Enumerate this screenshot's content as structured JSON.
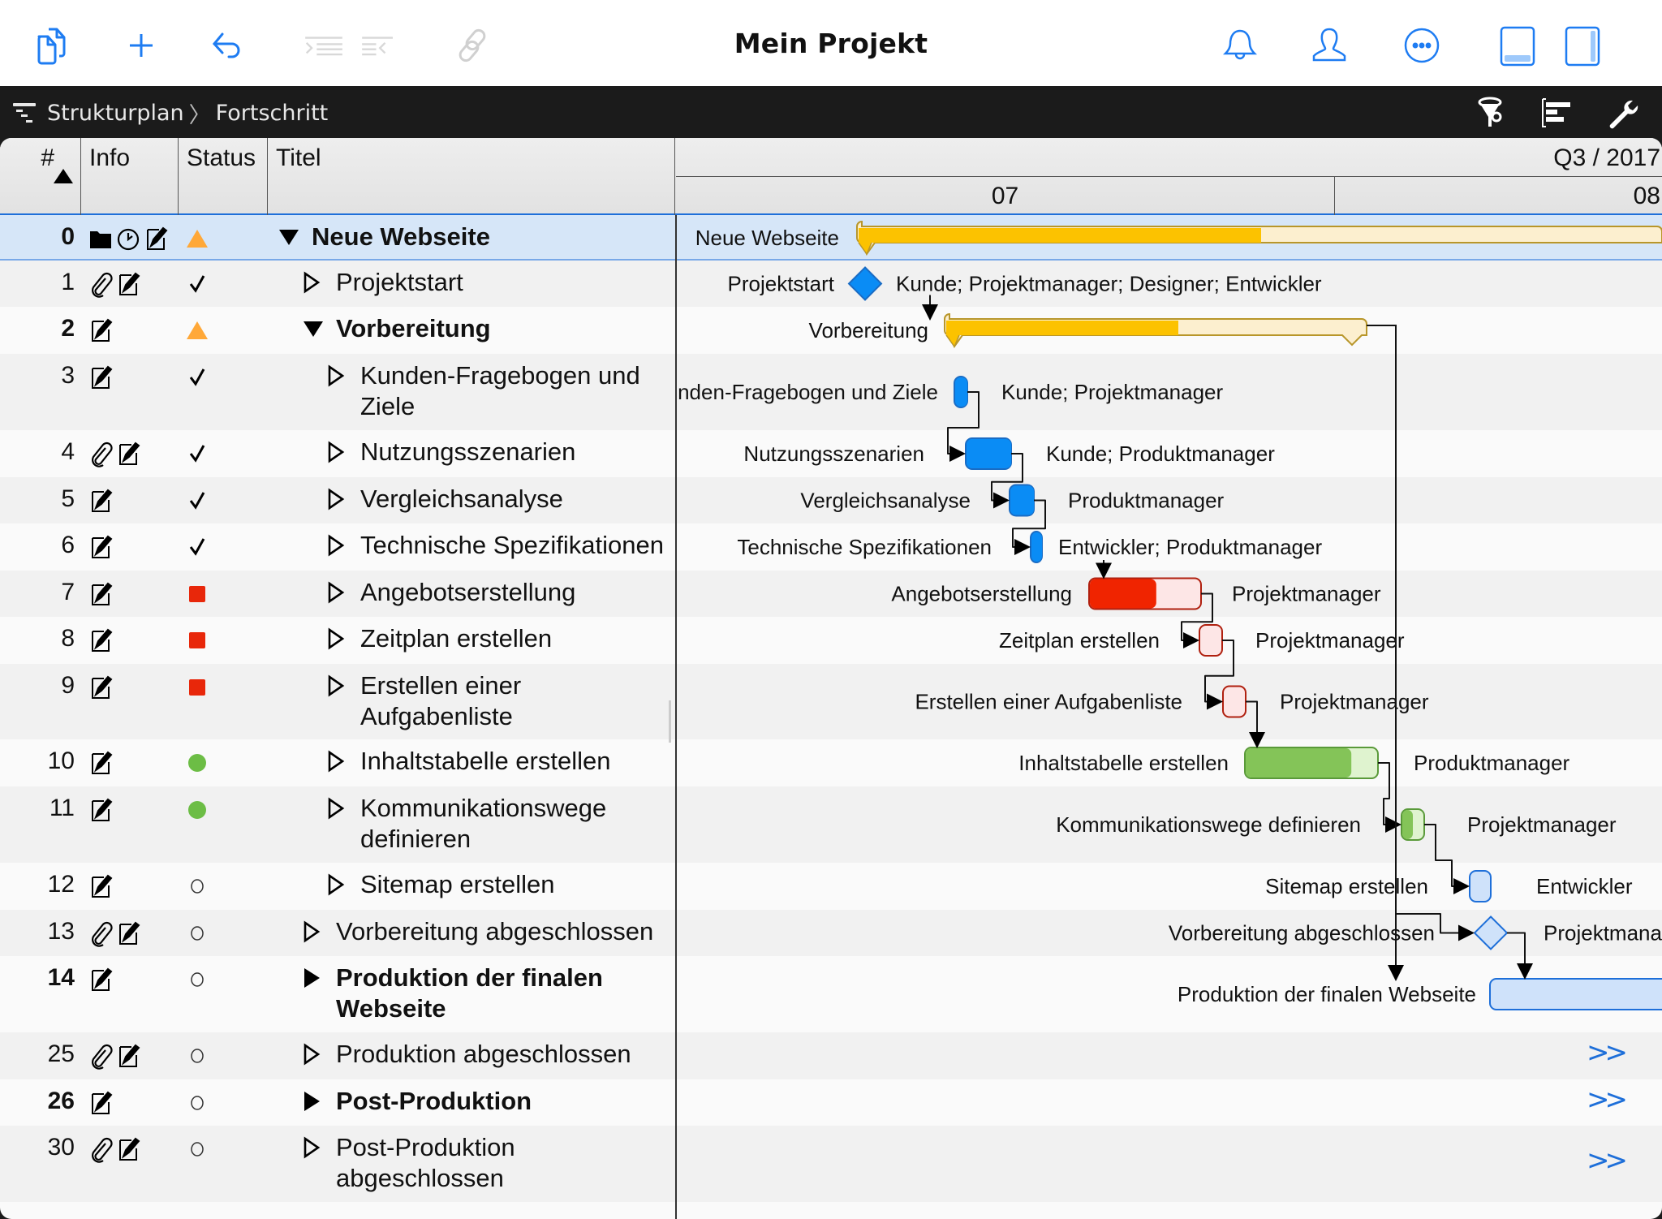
{
  "app": {
    "title": "Mein Projekt"
  },
  "toolbar": {
    "left_icons": [
      "duplicate-icon",
      "add-icon",
      "undo-icon",
      "indent-icon",
      "outdent-icon",
      "link-icon"
    ],
    "right_icons": [
      "bell-icon",
      "person-icon",
      "more-icon",
      "bottom-panel-icon",
      "side-panel-icon"
    ]
  },
  "breadcrumb": {
    "items": [
      "Strukturplan",
      "Fortschritt"
    ],
    "right_icons": [
      "filter-icon",
      "gantt-view-icon",
      "wrench-icon"
    ]
  },
  "table": {
    "columns": [
      "#",
      "Info",
      "Status",
      "Titel"
    ],
    "sort": "ascending",
    "rows": [
      {
        "num": "0",
        "bold": true,
        "info": [
          "folder",
          "clock",
          "note"
        ],
        "status": "warning-triangle",
        "expander": "expanded",
        "indent": 0,
        "title": "Neue Webseite",
        "selected": true
      },
      {
        "num": "1",
        "bold": false,
        "info": [
          "attachment",
          "note"
        ],
        "status": "check",
        "expander": "collapsed-outline",
        "indent": 1,
        "title": "Projektstart"
      },
      {
        "num": "2",
        "bold": true,
        "info": [
          "note"
        ],
        "status": "warning-triangle",
        "expander": "expanded",
        "indent": 1,
        "title": "Vorbereitung"
      },
      {
        "num": "3",
        "bold": false,
        "info": [
          "note"
        ],
        "status": "check",
        "expander": "collapsed-outline",
        "indent": 2,
        "title": "Kunden-Fragebogen und Ziele",
        "title_lines": [
          "Kunden-Fragebogen und",
          "Ziele"
        ]
      },
      {
        "num": "4",
        "bold": false,
        "info": [
          "attachment",
          "note"
        ],
        "status": "check",
        "expander": "collapsed-outline",
        "indent": 2,
        "title": "Nutzungsszenarien"
      },
      {
        "num": "5",
        "bold": false,
        "info": [
          "note"
        ],
        "status": "check",
        "expander": "collapsed-outline",
        "indent": 2,
        "title": "Vergleichsanalyse"
      },
      {
        "num": "6",
        "bold": false,
        "info": [
          "note"
        ],
        "status": "check",
        "expander": "collapsed-outline",
        "indent": 2,
        "title": "Technische Spezifikationen"
      },
      {
        "num": "7",
        "bold": false,
        "info": [
          "note"
        ],
        "status": "red-square",
        "expander": "collapsed-outline",
        "indent": 2,
        "title": "Angebotserstellung"
      },
      {
        "num": "8",
        "bold": false,
        "info": [
          "note"
        ],
        "status": "red-square",
        "expander": "collapsed-outline",
        "indent": 2,
        "title": "Zeitplan erstellen"
      },
      {
        "num": "9",
        "bold": false,
        "info": [
          "note"
        ],
        "status": "red-square",
        "expander": "collapsed-outline",
        "indent": 2,
        "title": "Erstellen einer Aufgabenliste",
        "title_lines": [
          "Erstellen einer",
          "Aufgabenliste"
        ]
      },
      {
        "num": "10",
        "bold": false,
        "info": [
          "note"
        ],
        "status": "green-dot",
        "expander": "collapsed-outline",
        "indent": 2,
        "title": "Inhaltstabelle erstellen"
      },
      {
        "num": "11",
        "bold": false,
        "info": [
          "note"
        ],
        "status": "green-dot",
        "expander": "collapsed-outline",
        "indent": 2,
        "title": "Kommunikationswege definieren",
        "title_lines": [
          "Kommunikationswege",
          "definieren"
        ]
      },
      {
        "num": "12",
        "bold": false,
        "info": [
          "note"
        ],
        "status": "empty-circle",
        "expander": "collapsed-outline",
        "indent": 2,
        "title": "Sitemap erstellen"
      },
      {
        "num": "13",
        "bold": false,
        "info": [
          "attachment",
          "note"
        ],
        "status": "empty-circle",
        "expander": "collapsed-outline",
        "indent": 1,
        "title": "Vorbereitung abgeschlossen"
      },
      {
        "num": "14",
        "bold": true,
        "info": [
          "note"
        ],
        "status": "empty-circle",
        "expander": "collapsed-filled",
        "indent": 1,
        "title": "Produktion der finalen Webseite",
        "title_lines": [
          "Produktion der finalen",
          "Webseite"
        ]
      },
      {
        "num": "25",
        "bold": false,
        "info": [
          "attachment",
          "note"
        ],
        "status": "empty-circle",
        "expander": "collapsed-outline",
        "indent": 1,
        "title": "Produktion abgeschlossen"
      },
      {
        "num": "26",
        "bold": true,
        "info": [
          "note"
        ],
        "status": "empty-circle",
        "expander": "collapsed-filled",
        "indent": 1,
        "title": "Post-Produktion"
      },
      {
        "num": "30",
        "bold": false,
        "info": [
          "attachment",
          "note"
        ],
        "status": "empty-circle",
        "expander": "collapsed-outline",
        "indent": 1,
        "title": "Post-Produktion abgeschlossen",
        "title_lines": [
          "Post-Produktion",
          "abgeschlossen"
        ]
      }
    ]
  },
  "timeline": {
    "quarter": "Q3 / 2017",
    "months": [
      "07",
      "08"
    ],
    "more_marker": ">>"
  },
  "colors": {
    "accent": "#1e7cf2",
    "summary_fill": "#fcc200",
    "summary_remaining": "#fcefcf",
    "done_blue": "#0a8cf5",
    "late_red": "#f02400",
    "late_red_light": "#fde6e6",
    "ok_green": "#84c458",
    "ok_green_light": "#dff3cf",
    "future_blue": "#cfe2fa",
    "warning_orange": "#ffa838"
  },
  "chart_data": {
    "type": "gantt",
    "title": "Mein Projekt",
    "time_axis": {
      "quarter": "Q3 / 2017",
      "months": [
        "07",
        "08"
      ]
    },
    "tasks": [
      {
        "id": 0,
        "label": "Neue Webseite",
        "kind": "summary",
        "progress": 0.5,
        "resources": ""
      },
      {
        "id": 1,
        "label": "Projektstart",
        "kind": "milestone",
        "done": true,
        "resources": "Kunde; Projektmanager; Designer; Entwickler"
      },
      {
        "id": 2,
        "label": "Vorbereitung",
        "kind": "summary",
        "progress": 0.55,
        "resources": ""
      },
      {
        "id": 3,
        "label": "Kunden-Fragebogen und Ziele",
        "kind": "task",
        "state": "done",
        "progress": 1.0,
        "resources": "Kunde; Projektmanager"
      },
      {
        "id": 4,
        "label": "Nutzungsszenarien",
        "kind": "task",
        "state": "done",
        "progress": 1.0,
        "resources": "Kunde; Produktmanager"
      },
      {
        "id": 5,
        "label": "Vergleichsanalyse",
        "kind": "task",
        "state": "done",
        "progress": 1.0,
        "resources": "Produktmanager"
      },
      {
        "id": 6,
        "label": "Technische Spezifikationen",
        "kind": "task",
        "state": "done",
        "progress": 1.0,
        "resources": "Entwickler; Produktmanager"
      },
      {
        "id": 7,
        "label": "Angebotserstellung",
        "kind": "task",
        "state": "late",
        "progress": 0.6,
        "resources": "Projektmanager"
      },
      {
        "id": 8,
        "label": "Zeitplan erstellen",
        "kind": "task",
        "state": "late",
        "progress": 0.0,
        "resources": "Projektmanager"
      },
      {
        "id": 9,
        "label": "Erstellen einer Aufgabenliste",
        "kind": "task",
        "state": "late",
        "progress": 0.0,
        "resources": "Projektmanager"
      },
      {
        "id": 10,
        "label": "Inhaltstabelle erstellen",
        "kind": "task",
        "state": "on-track",
        "progress": 0.8,
        "resources": "Produktmanager"
      },
      {
        "id": 11,
        "label": "Kommunikationswege definieren",
        "kind": "task",
        "state": "on-track",
        "progress": 0.5,
        "resources": "Projektmanager"
      },
      {
        "id": 12,
        "label": "Sitemap erstellen",
        "kind": "task",
        "state": "future",
        "progress": 0.0,
        "resources": "Entwickler"
      },
      {
        "id": 13,
        "label": "Vorbereitung abgeschlossen",
        "kind": "milestone",
        "done": false,
        "resources": "Projektmana"
      },
      {
        "id": 14,
        "label": "Produktion der finalen Webseite",
        "kind": "task",
        "state": "future",
        "progress": 0.0,
        "resources": ""
      },
      {
        "id": 25,
        "label": "Produktion abgeschlossen",
        "kind": "offscreen",
        "resources": ""
      },
      {
        "id": 26,
        "label": "Post-Produktion",
        "kind": "offscreen",
        "resources": ""
      },
      {
        "id": 30,
        "label": "Post-Produktion abgeschlossen",
        "kind": "offscreen",
        "resources": ""
      }
    ],
    "dependencies": [
      [
        1,
        2
      ],
      [
        3,
        4
      ],
      [
        4,
        5
      ],
      [
        5,
        6
      ],
      [
        6,
        7
      ],
      [
        7,
        8
      ],
      [
        8,
        9
      ],
      [
        9,
        10
      ],
      [
        10,
        11
      ],
      [
        11,
        12
      ],
      [
        2,
        13
      ],
      [
        12,
        13
      ],
      [
        13,
        14
      ]
    ]
  }
}
